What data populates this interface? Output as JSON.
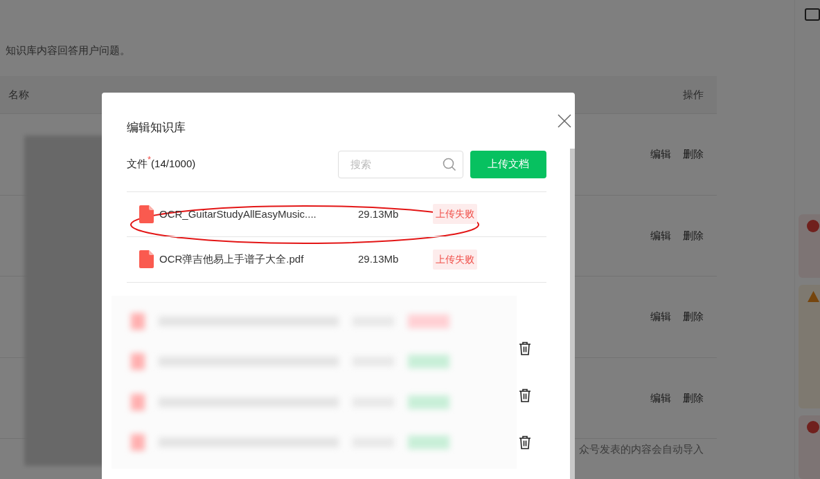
{
  "page": {
    "description": "知识库内容回答用户问题。",
    "columns": [
      "名称",
      "操作"
    ],
    "rows": [
      {
        "actions": [
          "编辑",
          "删除"
        ]
      },
      {
        "actions": [
          "编辑",
          "删除"
        ]
      },
      {
        "actions": [
          "编辑",
          "删除"
        ]
      },
      {
        "actions": [
          "编辑",
          "删除"
        ]
      }
    ],
    "footer_note": "众号发表的内容会自动导入"
  },
  "notifications": [
    {
      "kind": "error"
    },
    {
      "kind": "warning"
    },
    {
      "kind": "error"
    }
  ],
  "dialog": {
    "title": "编辑知识库",
    "files_label": "文件",
    "required_mark": "*",
    "count": "(14/1000)",
    "search": {
      "placeholder": "搜索"
    },
    "upload_button": "上传文档",
    "files": [
      {
        "name": "OCR_GuitarStudyAllEasyMusic....",
        "size": "29.13Mb",
        "status": "上传失败",
        "kind": "failed",
        "highlighted": true
      },
      {
        "name": "OCR弹吉他易上手谱子大全.pdf",
        "size": "29.13Mb",
        "status": "上传失败",
        "kind": "failed",
        "highlighted": false
      }
    ]
  }
}
